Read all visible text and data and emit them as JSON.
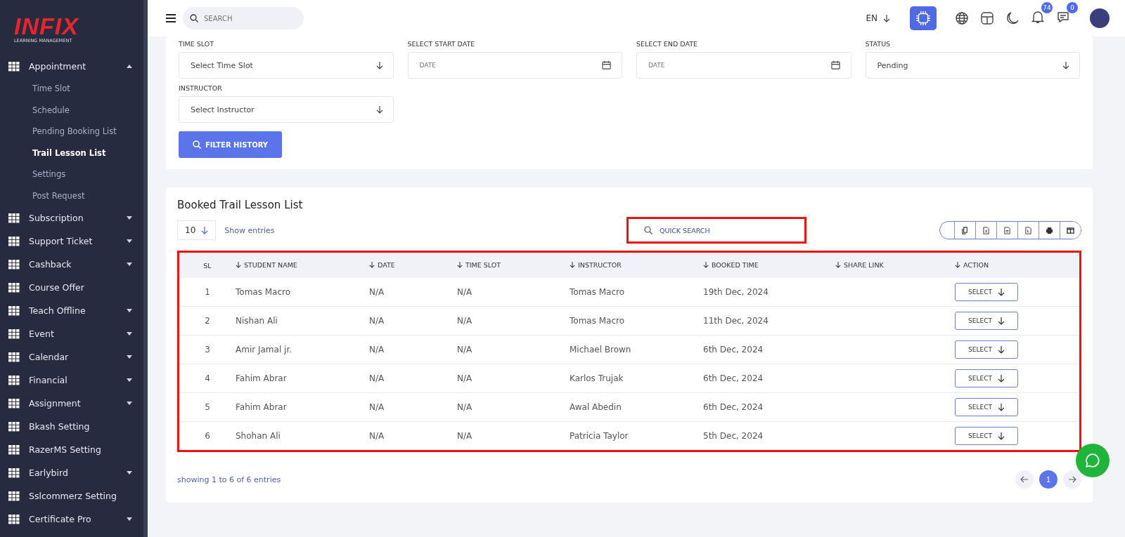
{
  "logo": {
    "name": "INFIX",
    "tagline": "LEARNING MANAGEMENT"
  },
  "sidebar": {
    "items": [
      {
        "label": "Appointment",
        "has_submenu": true,
        "expanded": true,
        "children": [
          {
            "label": "Time Slot",
            "selected": false
          },
          {
            "label": "Schedule",
            "selected": false
          },
          {
            "label": "Pending Booking List",
            "selected": false
          },
          {
            "label": "Trail Lesson List",
            "selected": true
          },
          {
            "label": "Settings",
            "selected": false
          },
          {
            "label": "Post Request",
            "selected": false
          }
        ]
      },
      {
        "label": "Subscription",
        "has_submenu": true,
        "expanded": false
      },
      {
        "label": "Support Ticket",
        "has_submenu": true,
        "expanded": false
      },
      {
        "label": "Cashback",
        "has_submenu": true,
        "expanded": false
      },
      {
        "label": "Course Offer",
        "has_submenu": false
      },
      {
        "label": "Teach Offline",
        "has_submenu": true,
        "expanded": false
      },
      {
        "label": "Event",
        "has_submenu": true,
        "expanded": false
      },
      {
        "label": "Calendar",
        "has_submenu": true,
        "expanded": false
      },
      {
        "label": "Financial",
        "has_submenu": true,
        "expanded": false
      },
      {
        "label": "Assignment",
        "has_submenu": true,
        "expanded": false
      },
      {
        "label": "Bkash Setting",
        "has_submenu": false
      },
      {
        "label": "RazerMS Setting",
        "has_submenu": false
      },
      {
        "label": "Earlybird",
        "has_submenu": true,
        "expanded": false
      },
      {
        "label": "Sslcommerz Setting",
        "has_submenu": false
      },
      {
        "label": "Certificate Pro",
        "has_submenu": true,
        "expanded": false
      }
    ]
  },
  "topbar": {
    "search_placeholder": "SEARCH",
    "language": "EN",
    "notifications": "74",
    "messages": "0"
  },
  "filters": [
    {
      "label": "TIME SLOT",
      "kind": "select",
      "value": "Select Time Slot"
    },
    {
      "label": "SELECT START DATE",
      "kind": "date",
      "placeholder": "DATE"
    },
    {
      "label": "SELECT END DATE",
      "kind": "date",
      "placeholder": "DATE"
    },
    {
      "label": "STATUS",
      "kind": "select",
      "value": "Pending"
    },
    {
      "label": "INSTRUCTOR",
      "kind": "select",
      "value": "Select Instructor"
    }
  ],
  "filter_button": "FILTER HISTORY",
  "table_card": {
    "title": "Booked Trail Lesson List",
    "page_size": "10",
    "show_entries": "Show entries",
    "quick_search_placeholder": "QUICK SEARCH",
    "columns": [
      {
        "label": "SL",
        "sortable": false
      },
      {
        "label": "STUDENT NAME",
        "sortable": true
      },
      {
        "label": "DATE",
        "sortable": true
      },
      {
        "label": "TIME SLOT",
        "sortable": true
      },
      {
        "label": "INSTRUCTOR",
        "sortable": true
      },
      {
        "label": "BOOKED TIME",
        "sortable": true
      },
      {
        "label": "SHARE LINK",
        "sortable": true
      },
      {
        "label": "ACTION",
        "sortable": true
      }
    ],
    "rows": [
      {
        "sl": "1",
        "student": "Tomas Macro",
        "date": "N/A",
        "time_slot": "N/A",
        "instructor": "Tomas Macro",
        "booked": "19th Dec, 2024",
        "action": "SELECT"
      },
      {
        "sl": "2",
        "student": "Nishan Ali",
        "date": "N/A",
        "time_slot": "N/A",
        "instructor": "Tomas Macro",
        "booked": "11th Dec, 2024",
        "action": "SELECT"
      },
      {
        "sl": "3",
        "student": "Amir Jamal jr.",
        "date": "N/A",
        "time_slot": "N/A",
        "instructor": "Michael Brown",
        "booked": "6th Dec, 2024",
        "action": "SELECT"
      },
      {
        "sl": "4",
        "student": "Fahim Abrar",
        "date": "N/A",
        "time_slot": "N/A",
        "instructor": "Karlos Trujak",
        "booked": "6th Dec, 2024",
        "action": "SELECT"
      },
      {
        "sl": "5",
        "student": "Fahim Abrar",
        "date": "N/A",
        "time_slot": "N/A",
        "instructor": "Awal Abedin",
        "booked": "6th Dec, 2024",
        "action": "SELECT"
      },
      {
        "sl": "6",
        "student": "Shohan Ali",
        "date": "N/A",
        "time_slot": "N/A",
        "instructor": "Patricia Taylor",
        "booked": "5th Dec, 2024",
        "action": "SELECT"
      }
    ],
    "summary": "showing 1 to 6 of 6 entries",
    "pages": [
      {
        "label": "1",
        "selected": true
      }
    ]
  }
}
